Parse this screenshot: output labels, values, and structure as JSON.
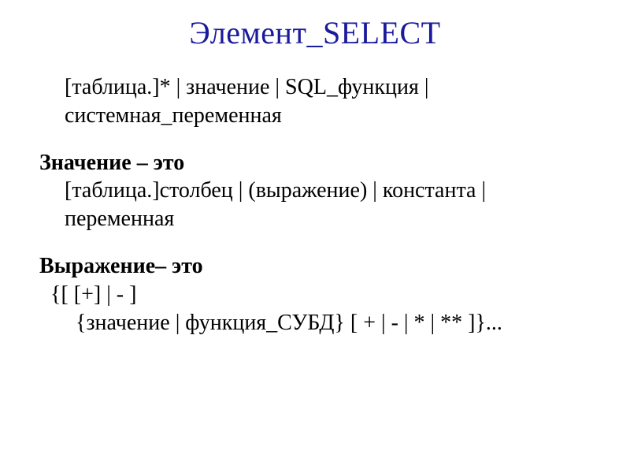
{
  "title": "Элемент_SELECT",
  "syntax_line": "[таблица.]* | значение | SQL_функция | системная_переменная",
  "value_heading": "Значение – это",
  "value_body": "[таблица.]столбец | (выражение) | константа | переменная",
  "expr_heading": "Выражение– это",
  "expr_line1": "{[ [+] | - ]",
  "expr_line2": "{значение | функция_СУБД} [ + | - | * | ** ]}..."
}
